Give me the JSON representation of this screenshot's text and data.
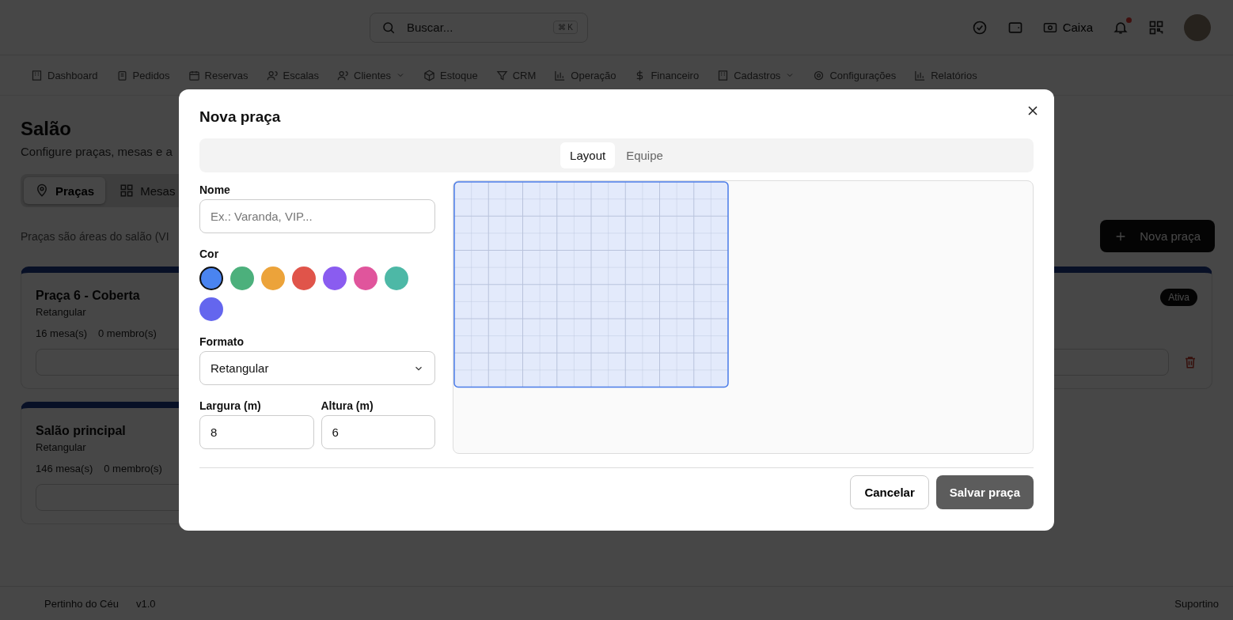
{
  "header": {
    "search": {
      "placeholder": "Buscar...",
      "shortcut": "⌘ K"
    },
    "cash_label": "Caixa",
    "notification_unread": true
  },
  "nav": [
    {
      "label": "Dashboard",
      "dropdown": false
    },
    {
      "label": "Pedidos",
      "dropdown": false
    },
    {
      "label": "Reservas",
      "dropdown": false
    },
    {
      "label": "Escalas",
      "dropdown": false
    },
    {
      "label": "Clientes",
      "dropdown": true
    },
    {
      "label": "Estoque",
      "dropdown": false
    },
    {
      "label": "CRM",
      "dropdown": false
    },
    {
      "label": "Operação",
      "dropdown": false
    },
    {
      "label": "Financeiro",
      "dropdown": false
    },
    {
      "label": "Cadastros",
      "dropdown": true
    },
    {
      "label": "Configurações",
      "dropdown": false
    },
    {
      "label": "Relatórios",
      "dropdown": false
    }
  ],
  "page": {
    "title": "Salão",
    "subtitle": "Configure praças, mesas e a",
    "tabs": [
      {
        "label": "Praças",
        "selected": true
      },
      {
        "label": "Mesas",
        "selected": false
      }
    ],
    "description": "Praças são áreas do salão (VI",
    "new_button": "Nova praça",
    "cards": [
      {
        "name": "Praça 6 - Coberta",
        "shape": "Retangular",
        "tables": "16 mesa(s)",
        "members": "0 membro(s)",
        "badge": "Ativa"
      },
      {
        "name": "Salão principal",
        "shape": "Retangular",
        "tables": "146 mesa(s)",
        "members": "0 membro(s)"
      }
    ]
  },
  "footer": {
    "brand": "Pertinho do Céu",
    "version": "v1.0",
    "support": "Suportino"
  },
  "modal": {
    "title": "Nova praça",
    "tabs": [
      {
        "label": "Layout",
        "selected": true
      },
      {
        "label": "Equipe",
        "selected": false
      }
    ],
    "name_label": "Nome",
    "name_placeholder": "Ex.: Varanda, VIP...",
    "color_label": "Cor",
    "colors": [
      {
        "color": "#4a84f0",
        "selected": true
      },
      {
        "color": "#4cb07c",
        "selected": false
      },
      {
        "color": "#eca33a",
        "selected": false
      },
      {
        "color": "#e0544a",
        "selected": false
      },
      {
        "color": "#8a5cf0",
        "selected": false
      },
      {
        "color": "#e0559c",
        "selected": false
      },
      {
        "color": "#4db8a6",
        "selected": false
      },
      {
        "color": "#6466ee",
        "selected": false
      }
    ],
    "shape_label": "Formato",
    "shape_value": "Retangular",
    "width_label": "Largura (m)",
    "width_value": "8",
    "height_label": "Altura (m)",
    "height_value": "6",
    "cancel": "Cancelar",
    "save": {
      "label": "Salvar praça",
      "disabled": true
    }
  }
}
